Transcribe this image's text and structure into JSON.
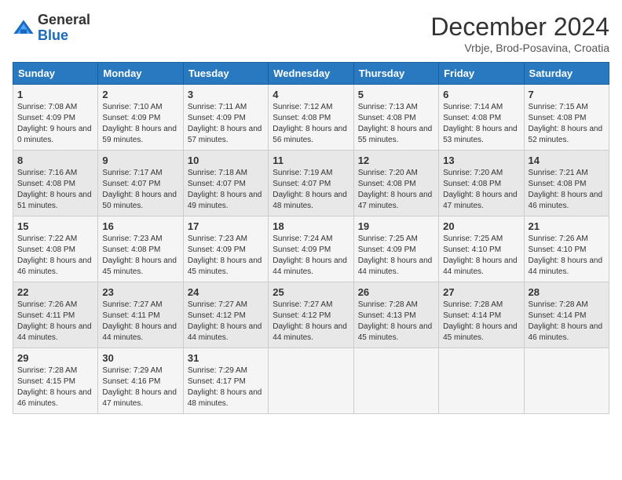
{
  "header": {
    "logo_general": "General",
    "logo_blue": "Blue",
    "title": "December 2024",
    "location": "Vrbje, Brod-Posavina, Croatia"
  },
  "days_of_week": [
    "Sunday",
    "Monday",
    "Tuesday",
    "Wednesday",
    "Thursday",
    "Friday",
    "Saturday"
  ],
  "weeks": [
    [
      {
        "day": "1",
        "sunrise": "7:08 AM",
        "sunset": "4:09 PM",
        "daylight": "9 hours and 0 minutes."
      },
      {
        "day": "2",
        "sunrise": "7:10 AM",
        "sunset": "4:09 PM",
        "daylight": "8 hours and 59 minutes."
      },
      {
        "day": "3",
        "sunrise": "7:11 AM",
        "sunset": "4:09 PM",
        "daylight": "8 hours and 57 minutes."
      },
      {
        "day": "4",
        "sunrise": "7:12 AM",
        "sunset": "4:08 PM",
        "daylight": "8 hours and 56 minutes."
      },
      {
        "day": "5",
        "sunrise": "7:13 AM",
        "sunset": "4:08 PM",
        "daylight": "8 hours and 55 minutes."
      },
      {
        "day": "6",
        "sunrise": "7:14 AM",
        "sunset": "4:08 PM",
        "daylight": "8 hours and 53 minutes."
      },
      {
        "day": "7",
        "sunrise": "7:15 AM",
        "sunset": "4:08 PM",
        "daylight": "8 hours and 52 minutes."
      }
    ],
    [
      {
        "day": "8",
        "sunrise": "7:16 AM",
        "sunset": "4:08 PM",
        "daylight": "8 hours and 51 minutes."
      },
      {
        "day": "9",
        "sunrise": "7:17 AM",
        "sunset": "4:07 PM",
        "daylight": "8 hours and 50 minutes."
      },
      {
        "day": "10",
        "sunrise": "7:18 AM",
        "sunset": "4:07 PM",
        "daylight": "8 hours and 49 minutes."
      },
      {
        "day": "11",
        "sunrise": "7:19 AM",
        "sunset": "4:07 PM",
        "daylight": "8 hours and 48 minutes."
      },
      {
        "day": "12",
        "sunrise": "7:20 AM",
        "sunset": "4:08 PM",
        "daylight": "8 hours and 47 minutes."
      },
      {
        "day": "13",
        "sunrise": "7:20 AM",
        "sunset": "4:08 PM",
        "daylight": "8 hours and 47 minutes."
      },
      {
        "day": "14",
        "sunrise": "7:21 AM",
        "sunset": "4:08 PM",
        "daylight": "8 hours and 46 minutes."
      }
    ],
    [
      {
        "day": "15",
        "sunrise": "7:22 AM",
        "sunset": "4:08 PM",
        "daylight": "8 hours and 46 minutes."
      },
      {
        "day": "16",
        "sunrise": "7:23 AM",
        "sunset": "4:08 PM",
        "daylight": "8 hours and 45 minutes."
      },
      {
        "day": "17",
        "sunrise": "7:23 AM",
        "sunset": "4:09 PM",
        "daylight": "8 hours and 45 minutes."
      },
      {
        "day": "18",
        "sunrise": "7:24 AM",
        "sunset": "4:09 PM",
        "daylight": "8 hours and 44 minutes."
      },
      {
        "day": "19",
        "sunrise": "7:25 AM",
        "sunset": "4:09 PM",
        "daylight": "8 hours and 44 minutes."
      },
      {
        "day": "20",
        "sunrise": "7:25 AM",
        "sunset": "4:10 PM",
        "daylight": "8 hours and 44 minutes."
      },
      {
        "day": "21",
        "sunrise": "7:26 AM",
        "sunset": "4:10 PM",
        "daylight": "8 hours and 44 minutes."
      }
    ],
    [
      {
        "day": "22",
        "sunrise": "7:26 AM",
        "sunset": "4:11 PM",
        "daylight": "8 hours and 44 minutes."
      },
      {
        "day": "23",
        "sunrise": "7:27 AM",
        "sunset": "4:11 PM",
        "daylight": "8 hours and 44 minutes."
      },
      {
        "day": "24",
        "sunrise": "7:27 AM",
        "sunset": "4:12 PM",
        "daylight": "8 hours and 44 minutes."
      },
      {
        "day": "25",
        "sunrise": "7:27 AM",
        "sunset": "4:12 PM",
        "daylight": "8 hours and 44 minutes."
      },
      {
        "day": "26",
        "sunrise": "7:28 AM",
        "sunset": "4:13 PM",
        "daylight": "8 hours and 45 minutes."
      },
      {
        "day": "27",
        "sunrise": "7:28 AM",
        "sunset": "4:14 PM",
        "daylight": "8 hours and 45 minutes."
      },
      {
        "day": "28",
        "sunrise": "7:28 AM",
        "sunset": "4:14 PM",
        "daylight": "8 hours and 46 minutes."
      }
    ],
    [
      {
        "day": "29",
        "sunrise": "7:28 AM",
        "sunset": "4:15 PM",
        "daylight": "8 hours and 46 minutes."
      },
      {
        "day": "30",
        "sunrise": "7:29 AM",
        "sunset": "4:16 PM",
        "daylight": "8 hours and 47 minutes."
      },
      {
        "day": "31",
        "sunrise": "7:29 AM",
        "sunset": "4:17 PM",
        "daylight": "8 hours and 48 minutes."
      },
      null,
      null,
      null,
      null
    ]
  ],
  "labels": {
    "sunrise": "Sunrise:",
    "sunset": "Sunset:",
    "daylight": "Daylight:"
  }
}
